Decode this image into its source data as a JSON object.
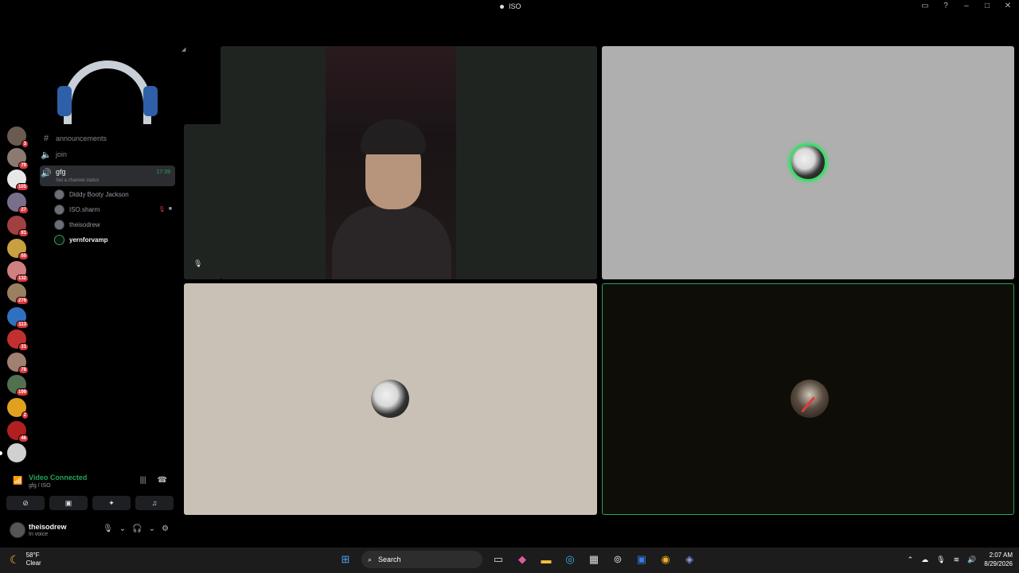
{
  "window": {
    "title": "ISO"
  },
  "servers": [
    {
      "badge": "3",
      "color": "#6b5a4f"
    },
    {
      "badge": "79",
      "color": "#8a7a70"
    },
    {
      "badge": "105",
      "color": "#e8e8e8"
    },
    {
      "badge": "27",
      "color": "#7a6f8a"
    },
    {
      "badge": "91",
      "color": "#a04040"
    },
    {
      "badge": "50",
      "color": "#c8a040"
    },
    {
      "badge": "132",
      "color": "#d08080"
    },
    {
      "badge": "276",
      "color": "#9a8060"
    },
    {
      "badge": "113",
      "color": "#3070c0"
    },
    {
      "badge": "31",
      "color": "#c03030"
    },
    {
      "badge": "78",
      "color": "#a08070"
    },
    {
      "badge": "199",
      "color": "#507050"
    },
    {
      "badge": "2",
      "color": "#e0a020"
    },
    {
      "badge": "46",
      "color": "#b02020"
    },
    {
      "badge": "",
      "color": "#d0d0d0"
    }
  ],
  "channels": {
    "announcements": "announcements",
    "join": "join",
    "active": {
      "name": "gfg",
      "time": "17:39",
      "status": "Set a channel status"
    },
    "voice_users": [
      {
        "name": "Diddy Booty Jackson"
      },
      {
        "name": "ISO.sharm"
      },
      {
        "name": "theisodrew"
      },
      {
        "name": "yernforvamp"
      }
    ]
  },
  "voice": {
    "status": "Video Connected",
    "sub": "gfg / ISO"
  },
  "user": {
    "name": "theisodrew",
    "state": "In voice"
  },
  "taskbar": {
    "temp": "58°F",
    "condition": "Clear",
    "search": "Search",
    "time": "2:07 AM",
    "date": "8/29/2026"
  }
}
